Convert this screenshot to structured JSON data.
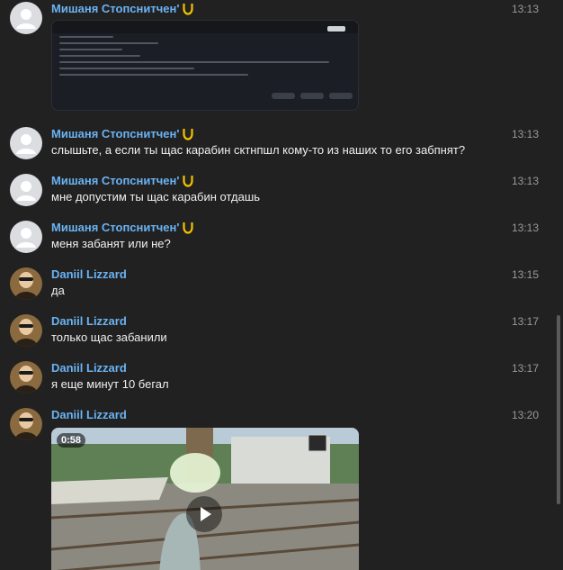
{
  "messages": [
    {
      "author": "Мишаня Стопснитчен'",
      "badge": "horseshoe-icon",
      "time": "13:13",
      "text": "",
      "attachment": "screenshot"
    },
    {
      "author": "Мишаня Стопснитчен'",
      "badge": "horseshoe-icon",
      "time": "13:13",
      "text": "слышьте, а если ты щас карабин сктнпшл кому-то из наших то его забпнят?"
    },
    {
      "author": "Мишаня Стопснитчен'",
      "badge": "horseshoe-icon",
      "time": "13:13",
      "text": "мне допустим ты щас карабин отдашь"
    },
    {
      "author": "Мишаня Стопснитчен'",
      "badge": "horseshoe-icon",
      "time": "13:13",
      "text": "меня забанят или не?"
    },
    {
      "author": "Daniil Lizzard",
      "time": "13:15",
      "text": "да"
    },
    {
      "author": "Daniil Lizzard",
      "time": "13:17",
      "text": "только щас забанили"
    },
    {
      "author": "Daniil Lizzard",
      "time": "13:17",
      "text": "я еще минут 10 бегал"
    },
    {
      "author": "Daniil Lizzard",
      "time": "13:20",
      "text": "",
      "attachment": "video",
      "video_duration": "0:58"
    }
  ],
  "colors": {
    "background": "#212121",
    "author_name": "#6ab3f3",
    "timestamp": "#9a9a9a",
    "message_text": "#f0f0f0",
    "badge": "#f2c200"
  }
}
